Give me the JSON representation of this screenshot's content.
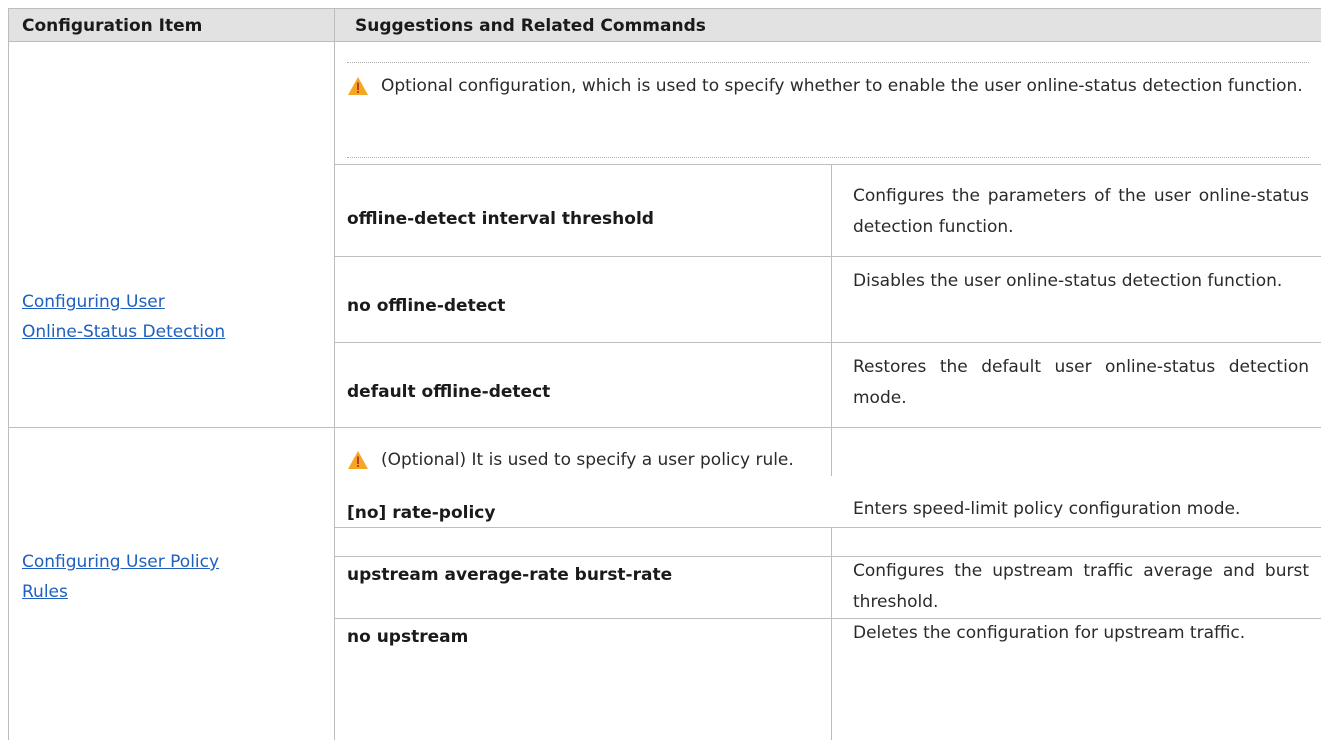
{
  "table": {
    "header": {
      "col1": "Configuration Item",
      "col2": "Suggestions and Related Commands"
    },
    "sections": [
      {
        "item_label_line1": "Configuring User",
        "item_label_line2": "Online-Status Detection",
        "note": "Optional configuration, which is used to specify whether to enable the user online-status detection function.",
        "commands": [
          {
            "command": "offline-detect interval threshold",
            "description": "Configures the parameters of the user online-status detection function."
          },
          {
            "command": "no offline-detect",
            "description": "Disables the user online-status detection function."
          },
          {
            "command": "default offline-detect",
            "description": "Restores the default user online-status detection mode."
          }
        ]
      },
      {
        "item_label_line1": "Configuring User Policy",
        "item_label_line2": "Rules",
        "note": "(Optional) It is used to specify a user policy rule.",
        "commands": [
          {
            "command": "[no] rate-policy",
            "description": "Enters speed-limit policy configuration mode."
          },
          {
            "command": "upstream average-rate burst-rate",
            "description": "Configures the upstream traffic average and burst threshold."
          },
          {
            "command": "no upstream",
            "description": "Deletes the configuration for upstream traffic."
          }
        ]
      }
    ]
  },
  "colors": {
    "header_bg": "#e2e2e2",
    "border": "#bdbdbd",
    "link": "#1f5fbf",
    "warning": "#f5a623"
  },
  "icons": [
    "warning-icon"
  ]
}
